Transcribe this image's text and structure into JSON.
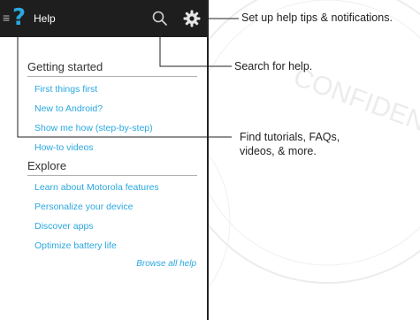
{
  "app": {
    "title": "Help"
  },
  "sections": [
    {
      "heading": "Getting started",
      "links": [
        "First things first",
        "New to Android?",
        "Show me how (step-by-step)",
        "How-to videos"
      ]
    },
    {
      "heading": "Explore",
      "links": [
        "Learn about Motorola features",
        "Personalize your device",
        "Discover apps",
        "Optimize battery life"
      ]
    }
  ],
  "browse_all": "Browse all help",
  "callouts": {
    "settings": "Set up help tips & notifications.",
    "search": "Search for help.",
    "menu_line1": "Find tutorials, FAQs,",
    "menu_line2": "videos, & more."
  },
  "watermark": {
    "text": "CONFIDENTIAL",
    "color": "#e8e8e8"
  },
  "colors": {
    "accent": "#2aa8e0",
    "appbar": "#1e1e1e"
  },
  "icons": [
    "menu-icon",
    "help-icon",
    "search-icon",
    "gear-icon"
  ]
}
